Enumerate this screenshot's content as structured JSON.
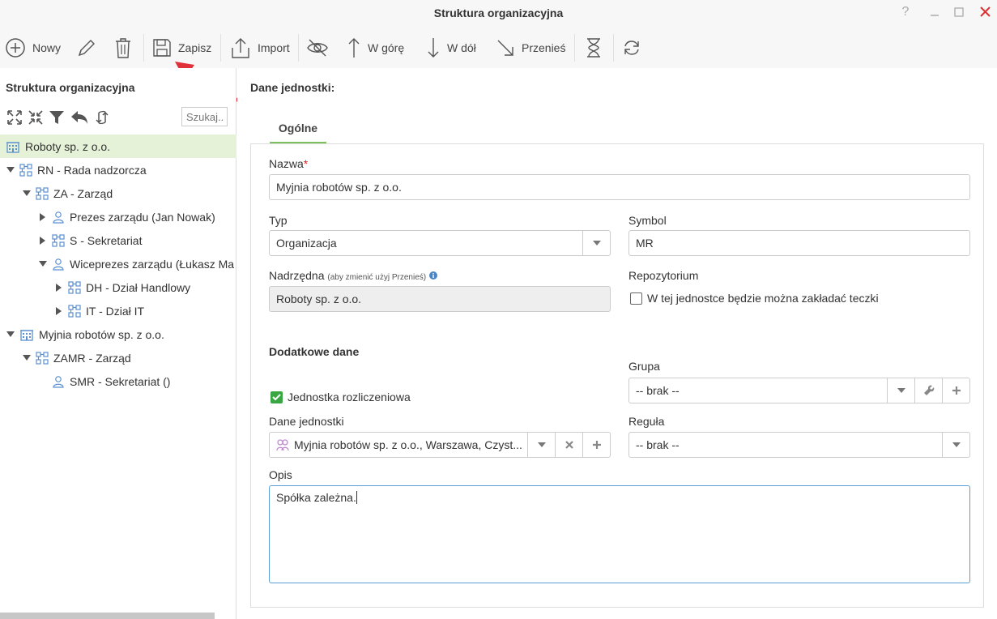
{
  "window": {
    "title": "Struktura organizacyjna",
    "help_label": "?"
  },
  "toolbar": {
    "new_label": "Nowy",
    "save_label": "Zapisz",
    "import_label": "Import",
    "up_label": "W górę",
    "down_label": "W dół",
    "move_label": "Przenieś"
  },
  "left_panel": {
    "title": "Struktura organizacyjna",
    "search_placeholder": "Szukaj..."
  },
  "tree": [
    {
      "label": "Roboty sp. z o.o.",
      "icon": "building-icon",
      "level": 0,
      "expander": "none",
      "selected": true
    },
    {
      "label": "RN - Rada nadzorcza",
      "icon": "org-unit-icon",
      "level": 0,
      "expander": "expanded"
    },
    {
      "label": "ZA - Zarząd",
      "icon": "org-unit-icon",
      "level": 1,
      "expander": "expanded"
    },
    {
      "label": "Prezes zarządu (Jan Nowak)",
      "icon": "person-icon",
      "level": 2,
      "expander": "collapsed"
    },
    {
      "label": "S - Sekretariat",
      "icon": "org-unit-icon",
      "level": 2,
      "expander": "collapsed"
    },
    {
      "label": "Wiceprezes zarządu (Łukasz Ma",
      "icon": "person-icon",
      "level": 2,
      "expander": "expanded"
    },
    {
      "label": "DH - Dział Handlowy",
      "icon": "org-unit-icon",
      "level": 3,
      "expander": "collapsed"
    },
    {
      "label": "IT - Dział IT",
      "icon": "org-unit-icon",
      "level": 3,
      "expander": "collapsed"
    },
    {
      "label": "Myjnia robotów sp. z o.o.",
      "icon": "building-icon",
      "level": 0,
      "expander": "expanded"
    },
    {
      "label": "ZAMR - Zarząd",
      "icon": "org-unit-icon",
      "level": 1,
      "expander": "expanded"
    },
    {
      "label": "SMR - Sekretariat ()",
      "icon": "person-icon",
      "level": 2,
      "expander": "none"
    }
  ],
  "details": {
    "section_title": "Dane jednostki:",
    "tab_general": "Ogólne",
    "name_label": "Nazwa",
    "name_required_mark": "*",
    "name_value": "Myjnia robotów sp. z o.o.",
    "type_label": "Typ",
    "type_value": "Organizacja",
    "symbol_label": "Symbol",
    "symbol_value": "MR",
    "parent_label": "Nadrzędna",
    "parent_hint": "(aby zmienić użyj Przenieś)",
    "parent_value": "Roboty sp. z o.o.",
    "repo_label": "Repozytorium",
    "repo_checkbox_label": "W tej jednostce będzie można zakładać teczki",
    "repo_checked": false,
    "extra_title": "Dodatkowe dane",
    "settlement_label": "Jednostka rozliczeniowa",
    "settlement_checked": true,
    "group_label": "Grupa",
    "group_value": "-- brak --",
    "unit_data_label": "Dane jednostki",
    "unit_data_value": "Myjnia robotów sp. z o.o., Warszawa, Czyst...",
    "rule_label": "Reguła",
    "rule_value": "-- brak --",
    "desc_label": "Opis",
    "desc_value": "Spółka zależna."
  },
  "colors": {
    "accent_green": "#7cbf5a",
    "selected_row": "#e5f2d8",
    "check_green": "#3aa643",
    "arrow_red": "#e0303a",
    "icon_blue": "#5b8fd0"
  }
}
